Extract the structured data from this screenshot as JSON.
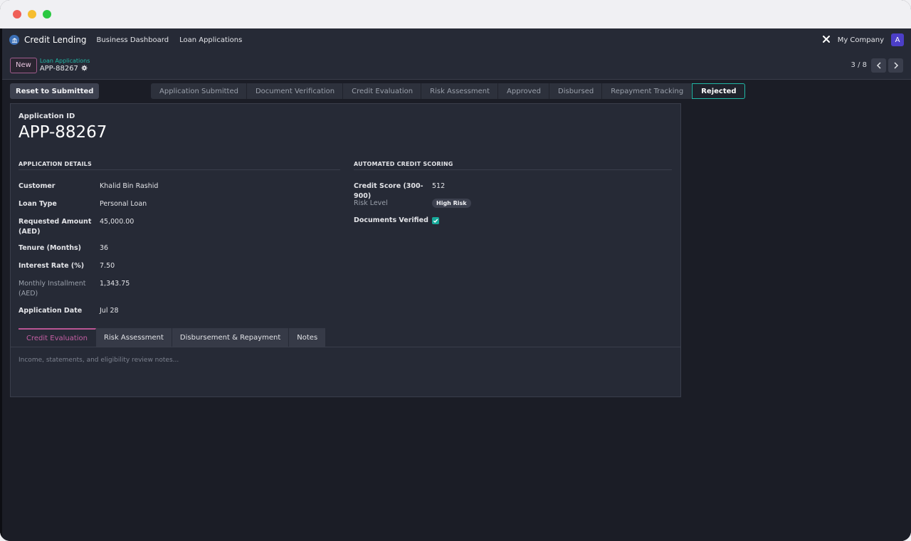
{
  "nav": {
    "brand": "Credit Lending",
    "links": [
      "Business Dashboard",
      "Loan Applications"
    ],
    "company": "My Company",
    "avatar": "A"
  },
  "control": {
    "new_label": "New",
    "breadcrumb_parent": "Loan Applications",
    "breadcrumb_current": "APP-88267",
    "pager": "3 / 8"
  },
  "status": {
    "reset_label": "Reset to Submitted",
    "stages": [
      "Application Submitted",
      "Document Verification",
      "Credit Evaluation",
      "Risk Assessment",
      "Approved",
      "Disbursed",
      "Repayment Tracking",
      "Rejected"
    ],
    "active_stage": "Rejected"
  },
  "record": {
    "id_label": "Application ID",
    "id": "APP-88267"
  },
  "details": {
    "title": "Application Details",
    "fields": [
      {
        "label": "Customer",
        "value": "Khalid Bin Rashid"
      },
      {
        "label": "Loan Type",
        "value": "Personal Loan"
      },
      {
        "label": "Requested Amount (AED)",
        "value": "45,000.00"
      },
      {
        "label": "Tenure (Months)",
        "value": "36"
      },
      {
        "label": "Interest Rate (%)",
        "value": "7.50"
      },
      {
        "label": "Monthly Installment (AED)",
        "value": "1,343.75"
      },
      {
        "label": "Application Date",
        "value": "Jul 28"
      }
    ]
  },
  "scoring": {
    "title": "Automated Credit Scoring",
    "credit_score_label": "Credit Score (300-900)",
    "credit_score": "512",
    "risk_label": "Risk Level",
    "risk_value": "High Risk",
    "docs_label": "Documents Verified",
    "docs_verified": true
  },
  "tabs": [
    "Credit Evaluation",
    "Risk Assessment",
    "Disbursement & Repayment",
    "Notes"
  ],
  "tab_content_placeholder": "Income, statements, and eligibility review notes...",
  "colors": {
    "accent_teal": "#21b8a6",
    "accent_pink": "#b95593",
    "background": "#1b1d26"
  }
}
